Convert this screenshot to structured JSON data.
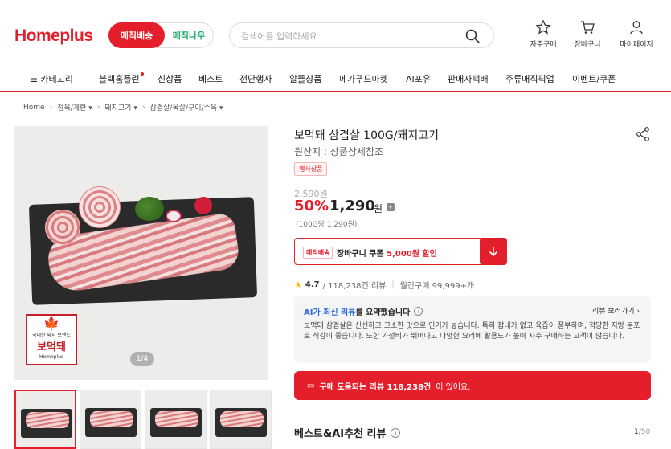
{
  "header": {
    "logo": "Homeplus",
    "delivery_active": "매직배송",
    "delivery_other": "매직나우",
    "search_placeholder": "검색어를 입력하세요",
    "buttons": [
      {
        "label": "자주구매",
        "icon": "star-icon"
      },
      {
        "label": "장바구니",
        "icon": "cart-icon"
      },
      {
        "label": "마이페이지",
        "icon": "user-icon"
      }
    ]
  },
  "nav": {
    "category": "카테고리",
    "items": [
      "블랙홈플런",
      "신상품",
      "베스트",
      "전단행사",
      "알뜰상품",
      "메가푸드마켓",
      "AI포유",
      "판매자택배",
      "주류매직픽업",
      "이벤트/쿠폰"
    ]
  },
  "breadcrumb": [
    "Home",
    "정육/계란",
    "돼지고기",
    "삼겹살/목살/구이/수육"
  ],
  "gallery": {
    "brand_name": "보먹돼",
    "brand_sub": "Homeplus",
    "brand_top": "국내산 돼지 브랜드",
    "counter": "1/4"
  },
  "product": {
    "title": "보먹돼 삼겹살 100G/돼지고기",
    "origin": "원산지 : 상품상세참조",
    "tag": "행사상품",
    "original_price": "2,590원",
    "discount": "50%",
    "sale_price": "1,290",
    "won": "원",
    "unit_price": "(100G당 1,290원)"
  },
  "coupon": {
    "tag": "매직배송",
    "text": "장바구니 쿠폰",
    "amount": "5,000원 할인"
  },
  "rating": {
    "score": "4.7",
    "reviews": "/ 118,238건 리뷰",
    "monthly": "월간구매 99,999+개"
  },
  "ai_summary": {
    "title_blue": "AI가 최신 리뷰",
    "title_rest": "를 요약했습니다",
    "link": "리뷰 보러가기",
    "body": "보먹돼 삼겹살은 신선하고 고소한 맛으로 인기가 높습니다. 특히 잡내가 없고 육즙이 풍부하며, 적당한 지방 분포로 식감이 좋습니다. 또한 가성비가 뛰어나고 다양한 요리에 활용도가 높아 자주 구매하는 고객이 많습니다."
  },
  "review_banner": {
    "strong": "구매 도움되는 리뷰 118,238건",
    "rest": "이 있어요."
  },
  "best_reviews": {
    "title": "베스트&AI추천 리뷰",
    "page": "1",
    "total": "/50"
  },
  "colors": {
    "brand": "#e41f2b",
    "now": "#1aa86a",
    "ai_blue": "#2b6ad8",
    "star": "#f5b400"
  }
}
